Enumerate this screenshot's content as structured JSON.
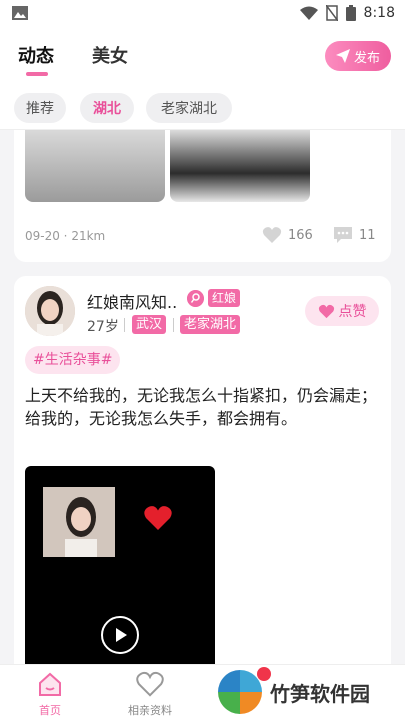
{
  "status_bar": {
    "time": "8:18"
  },
  "top_tabs": {
    "active": "动态",
    "second": "美女"
  },
  "publish_label": "发布",
  "filters": [
    "推荐",
    "湖北",
    "老家湖北"
  ],
  "card1": {
    "meta": "09-20 · 21km",
    "likes": "166",
    "comments": "11"
  },
  "card2": {
    "username": "红娘南风知..",
    "role_badge": "红娘",
    "age": "27岁",
    "city": "武汉",
    "hometown": "老家湖北",
    "like_label": "点赞",
    "topic": "#生活杂事#",
    "text": "上天不给我的，无论我怎么十指紧扣，仍会漏走；给我的，无论我怎么失手，都会拥有。"
  },
  "bottom_nav": {
    "home": "首页",
    "profile": "相亲资料"
  },
  "watermark": "竹笋软件园",
  "colors": {
    "accent": "#f26aa6",
    "accent_light": "#fde4ef"
  }
}
